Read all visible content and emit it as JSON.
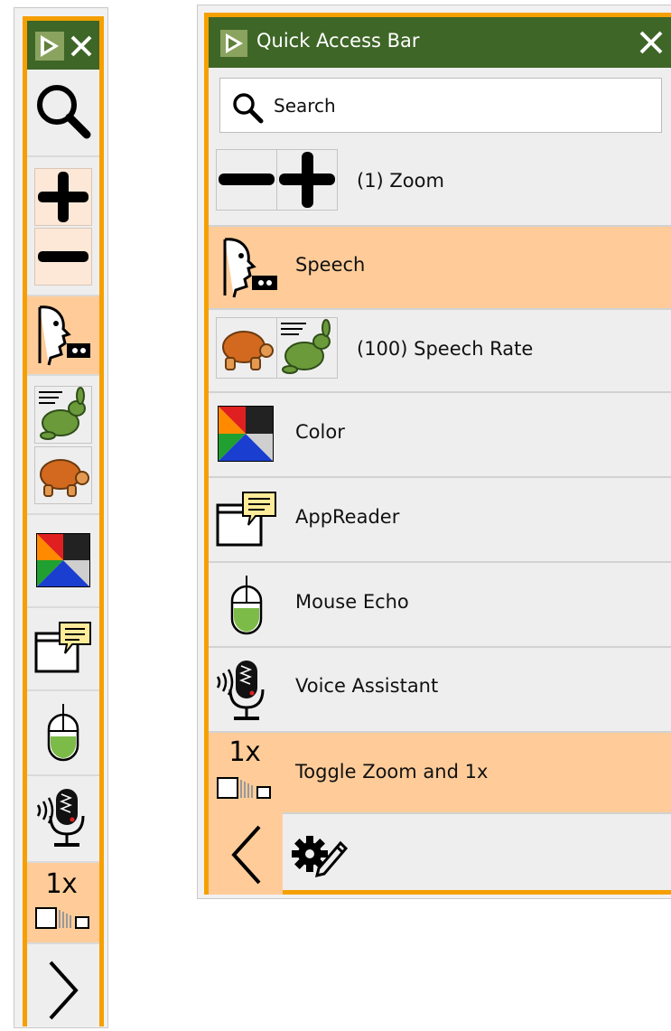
{
  "colors": {
    "accent_border": "#f5a000",
    "title_bar": "#3e6627",
    "highlight": "#ffcc99",
    "background": "#eeeeee"
  },
  "panel": {
    "title": "Quick Access Bar",
    "search_placeholder": "Search",
    "items": [
      {
        "id": "zoom",
        "label": "(1) Zoom",
        "icons": [
          "minus-icon",
          "plus-icon"
        ],
        "highlighted": false
      },
      {
        "id": "speech",
        "label": "Speech",
        "icons": [
          "speech-head-icon"
        ],
        "highlighted": true
      },
      {
        "id": "speech-rate",
        "label": "(100) Speech Rate",
        "icons": [
          "turtle-icon",
          "rabbit-icon"
        ],
        "highlighted": false
      },
      {
        "id": "color",
        "label": "Color",
        "icons": [
          "color-filter-icon"
        ],
        "highlighted": false
      },
      {
        "id": "appreader",
        "label": "AppReader",
        "icons": [
          "appreader-icon"
        ],
        "highlighted": false
      },
      {
        "id": "mouse-echo",
        "label": "Mouse Echo",
        "icons": [
          "mouse-icon"
        ],
        "highlighted": false
      },
      {
        "id": "voice-assistant",
        "label": "Voice Assistant",
        "icons": [
          "microphone-icon"
        ],
        "highlighted": false
      },
      {
        "id": "toggle-zoom",
        "label": "Toggle Zoom and 1x",
        "icons": [
          "toggle-zoom-icon"
        ],
        "highlighted": true
      }
    ],
    "footer": {
      "icons": [
        "back-chevron-icon",
        "settings-gear-pencil-icon"
      ]
    }
  },
  "collapsed": {
    "toggle_zoom_text": "1x",
    "items": [
      "search-icon",
      "zoom-in-icon",
      "zoom-out-icon",
      "speech-head-icon",
      "rabbit-icon",
      "turtle-icon",
      "color-filter-icon",
      "appreader-icon",
      "mouse-icon",
      "microphone-icon",
      "toggle-zoom-icon",
      "expand-chevron-icon"
    ]
  },
  "toggle_zoom_text": "1x"
}
